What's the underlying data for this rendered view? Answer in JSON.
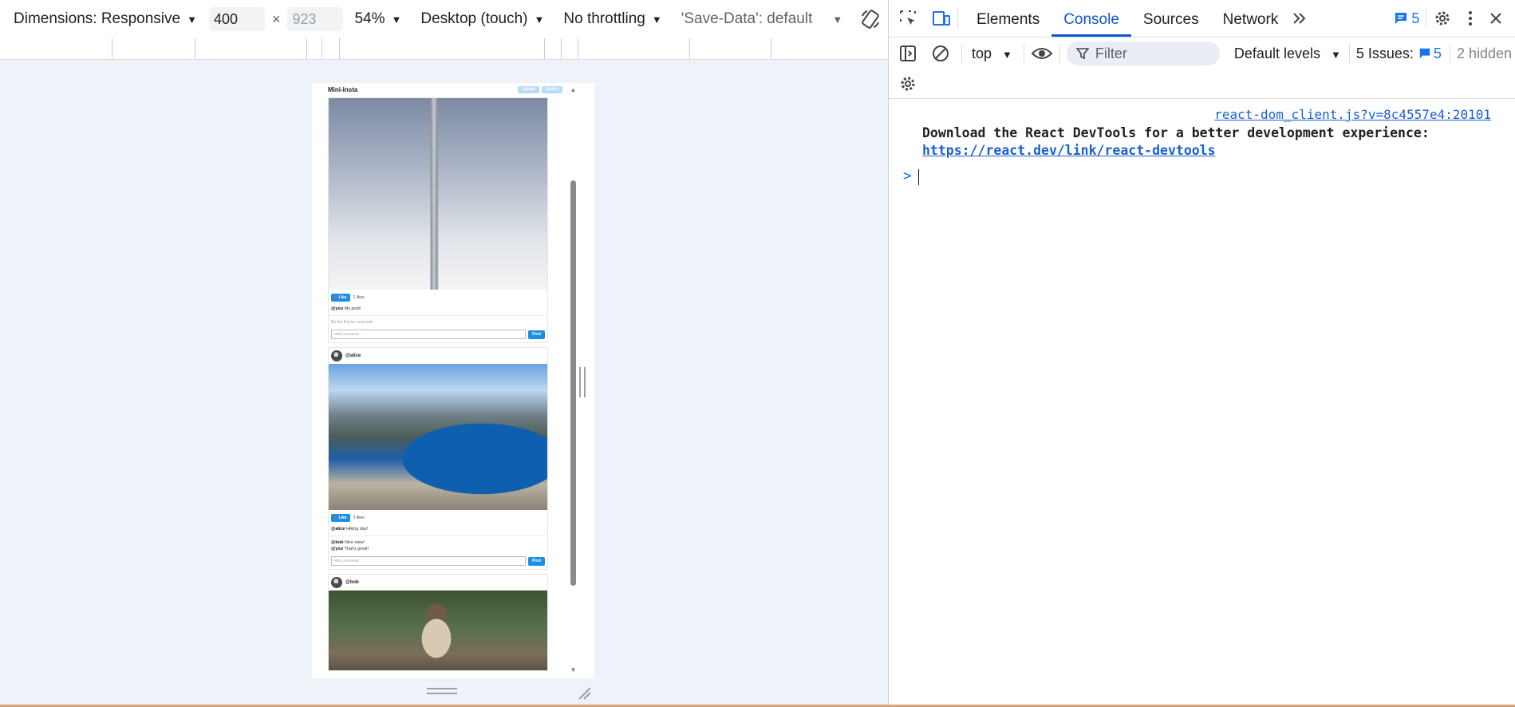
{
  "emulation_toolbar": {
    "dimensions_label": "Dimensions: Responsive",
    "width_value": "400",
    "height_placeholder": "923",
    "times": "×",
    "zoom": "54%",
    "device_mode": "Desktop (touch)",
    "throttling": "No throttling",
    "save_data": "'Save-Data': default"
  },
  "app": {
    "title": "Mini-Insta",
    "upload_label": "Upload",
    "user_label": "@alice",
    "posts": [
      {
        "username": "",
        "like_label": "Like",
        "likes": "1 likes",
        "caption_user": "@you",
        "caption_text": "My post!",
        "empty_comments": "Be the first to comment.",
        "comment_placeholder": "Add a comment...",
        "post_label": "Post"
      },
      {
        "username": "@alice",
        "like_label": "Like",
        "likes": "3 likes",
        "caption_user": "@alice",
        "caption_text": "Hiking day!",
        "comments": [
          {
            "user": "@bob",
            "text": "Nice view!"
          },
          {
            "user": "@you",
            "text": "That's great!"
          }
        ],
        "comment_placeholder": "Add a comment...",
        "post_label": "Post"
      },
      {
        "username": "@bob"
      }
    ]
  },
  "devtools": {
    "tabs": [
      "Elements",
      "Console",
      "Sources",
      "Network"
    ],
    "issues_badge": "5",
    "context": "top",
    "filter_placeholder": "Filter",
    "levels": "Default levels",
    "issues_label": "5 Issues:",
    "issues_count": "5",
    "hidden": "2 hidden",
    "message_source": "react-dom_client.js?v=8c4557e4:20101",
    "message_text": "Download the React DevTools for a better development experience:",
    "message_link": "https://react.dev/link/react-devtools",
    "prompt_symbol": ">"
  }
}
